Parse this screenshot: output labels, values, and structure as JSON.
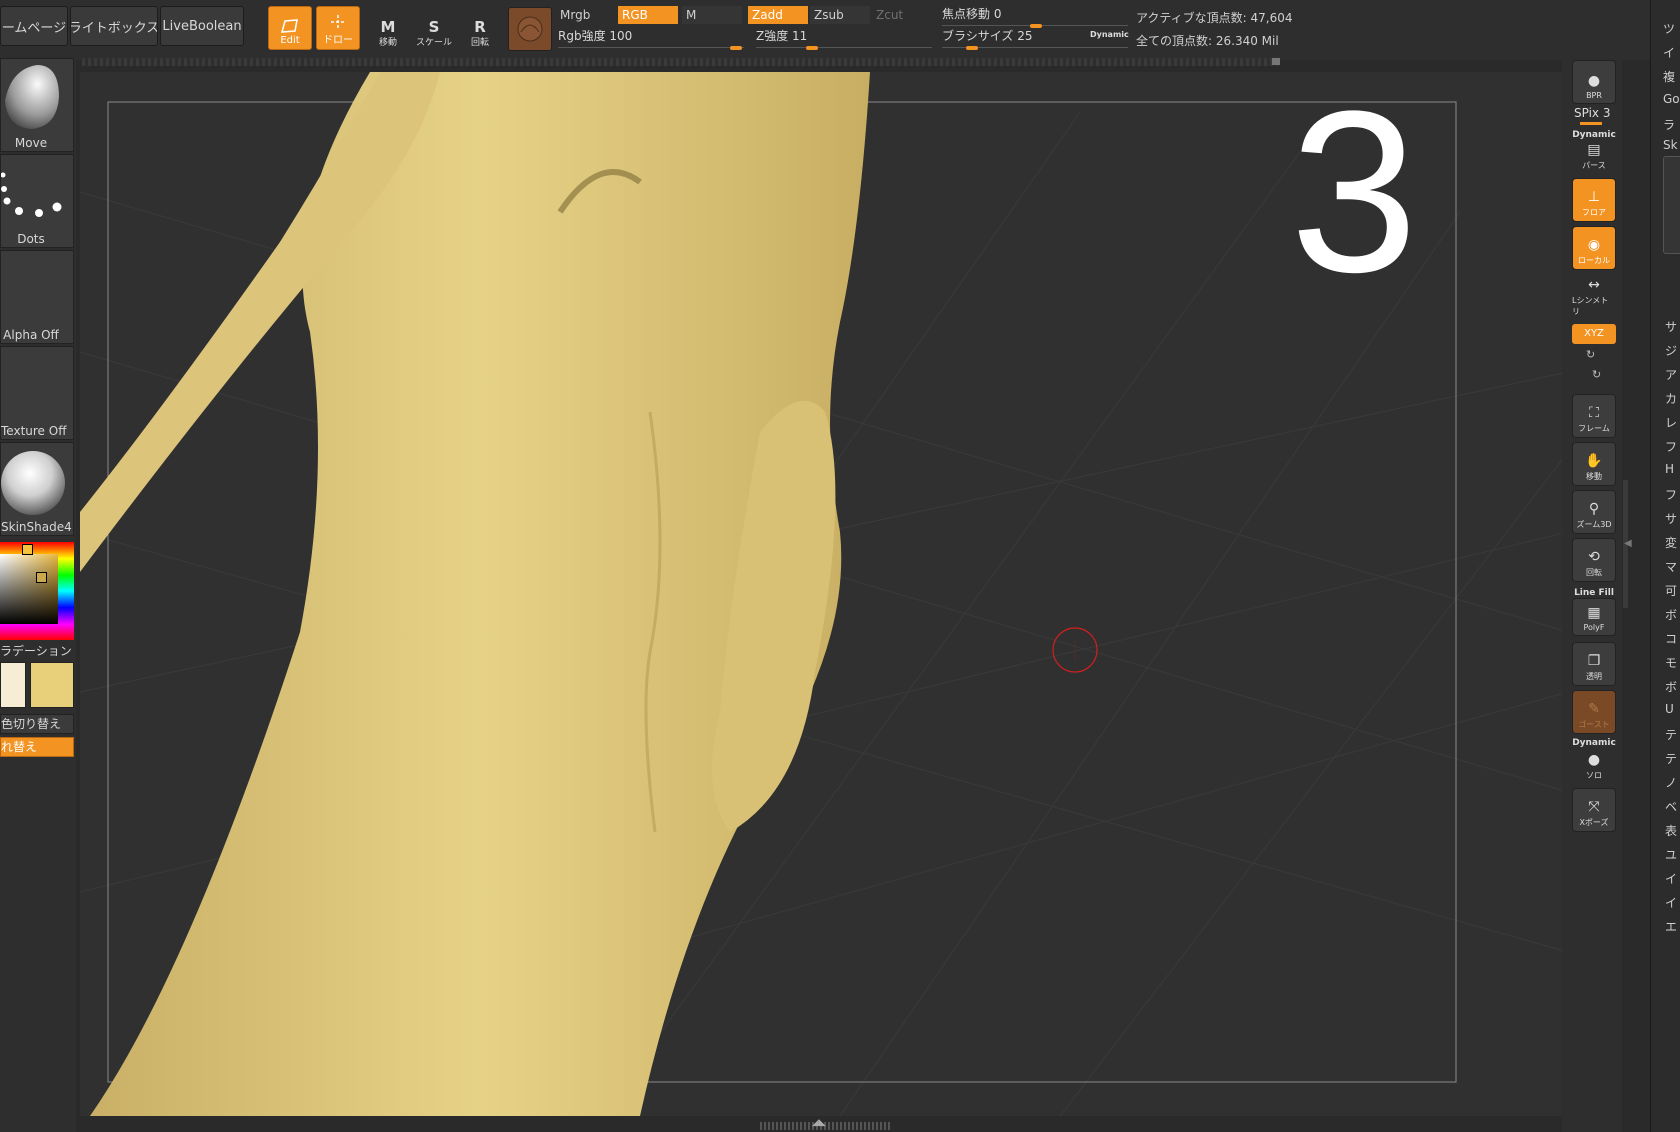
{
  "topbar": {
    "home_label": "ームページ",
    "lightbox_label": "ライトボックス",
    "liveboolean_label": "LiveBoolean",
    "edit_label": "Edit",
    "draw_label": "ドロー",
    "move_label": "移動",
    "scale_label": "スケール",
    "rotate_label": "回転",
    "move_glyph": "M",
    "scale_glyph": "S",
    "rotate_glyph": "R",
    "mrgb_label": "Mrgb",
    "rgb_label": "RGB",
    "m_label": "M",
    "zadd_label": "Zadd",
    "zsub_label": "Zsub",
    "zcut_label": "Zcut",
    "rgb_intensity_label": "Rgb強度 100",
    "rgb_intensity_value": 100,
    "z_intensity_label": "Z強度 11",
    "z_intensity_value": 11,
    "focal_shift_label": "焦点移動 0",
    "focal_shift_value": 0,
    "brush_size_label": "ブラシサイズ 25",
    "brush_size_value": 25,
    "dynamic_label": "Dynamic",
    "active_points": "アクティブな頂点数: 47,604",
    "total_points": "全ての頂点数: 26.340 Mil"
  },
  "leftshelf": {
    "brush_label": "Move",
    "stroke_label": "Dots",
    "alpha_label": "Alpha Off",
    "texture_label": "Texture Off",
    "material_label": "SkinShade4",
    "gradient_label": "ラデーション",
    "switch_color_label": "色切り替え",
    "alternate_label": "れ替え"
  },
  "canvas": {
    "overlay_number": "3"
  },
  "rightshelf": {
    "bpr_label": "BPR",
    "spix_label": "SPix 3",
    "dynamic_label": "Dynamic",
    "persp_label": "パース",
    "floor_label": "フロア",
    "local_label": "ローカル",
    "symmetry_label": "Lシンメトリ",
    "xyz_label": "XYZ",
    "frame_label": "フレーム",
    "move_label": "移動",
    "zoom_label": "ズーム3D",
    "rotate_label": "回転",
    "linefill_label": "Line Fill",
    "polyf_label": "PolyF",
    "transp_label": "透明",
    "ghost_label": "ゴースト",
    "dynamic2_label": "Dynamic",
    "solo_label": "ソロ",
    "xpose_label": "Xポーズ"
  },
  "farright": {
    "items": [
      "ツ",
      "イ",
      "複",
      "Go",
      "ラ",
      "Sk",
      "サ",
      "ジ",
      "ア",
      "カ",
      "レ",
      "フ",
      "H",
      "フ",
      "サ",
      "変",
      "マ",
      "可",
      "ボ",
      "コ",
      "モ",
      "ボ",
      "U",
      "テ",
      "テ",
      "ノ",
      "ベ",
      "表",
      "ユ",
      "イ",
      "イ",
      "エ"
    ]
  },
  "colors": {
    "accent": "#f39322",
    "model": "#e2cc7c",
    "primary_color": "#f7ecd4",
    "secondary_color": "#e8cf7a"
  }
}
